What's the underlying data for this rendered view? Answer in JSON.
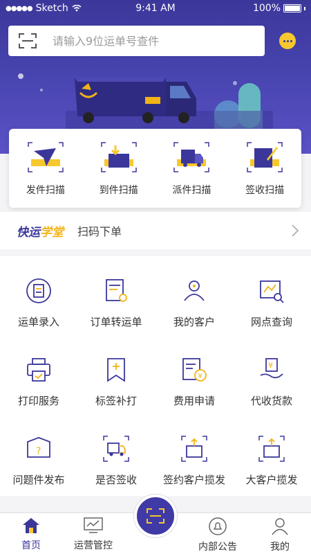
{
  "status_bar": {
    "carrier": "Sketch",
    "time": "9:41 AM",
    "battery": "100%"
  },
  "search": {
    "placeholder": "请输入9位运单号查件"
  },
  "colors": {
    "brand": "#3b379a",
    "accent": "#f7c82e"
  },
  "quick_actions": [
    {
      "label": "发件扫描",
      "icon": "send-scan-icon"
    },
    {
      "label": "到件扫描",
      "icon": "arrival-scan-icon"
    },
    {
      "label": "派件扫描",
      "icon": "delivery-scan-icon"
    },
    {
      "label": "签收扫描",
      "icon": "signoff-scan-icon"
    }
  ],
  "school": {
    "logo_part1": "快运",
    "logo_part2": "学堂",
    "text": "扫码下单"
  },
  "grid": [
    {
      "label": "运单录入",
      "icon": "waybill-entry-icon"
    },
    {
      "label": "订单转运单",
      "icon": "order-convert-icon"
    },
    {
      "label": "我的客户",
      "icon": "customers-icon"
    },
    {
      "label": "网点查询",
      "icon": "outlet-search-icon"
    },
    {
      "label": "打印服务",
      "icon": "printer-icon"
    },
    {
      "label": "标签补打",
      "icon": "label-reprint-icon"
    },
    {
      "label": "费用申请",
      "icon": "fee-request-icon"
    },
    {
      "label": "代收货款",
      "icon": "cod-icon"
    },
    {
      "label": "问题件发布",
      "icon": "problem-parcel-icon"
    },
    {
      "label": "是否签收",
      "icon": "sign-status-icon"
    },
    {
      "label": "签约客户揽发",
      "icon": "contract-pickup-icon"
    },
    {
      "label": "大客户揽发",
      "icon": "vip-pickup-icon"
    }
  ],
  "tabs": [
    {
      "label": "首页",
      "icon": "home-icon"
    },
    {
      "label": "运营管控",
      "icon": "monitor-icon"
    },
    {
      "label": "内部公告",
      "icon": "bell-icon"
    },
    {
      "label": "我的",
      "icon": "user-icon"
    }
  ]
}
